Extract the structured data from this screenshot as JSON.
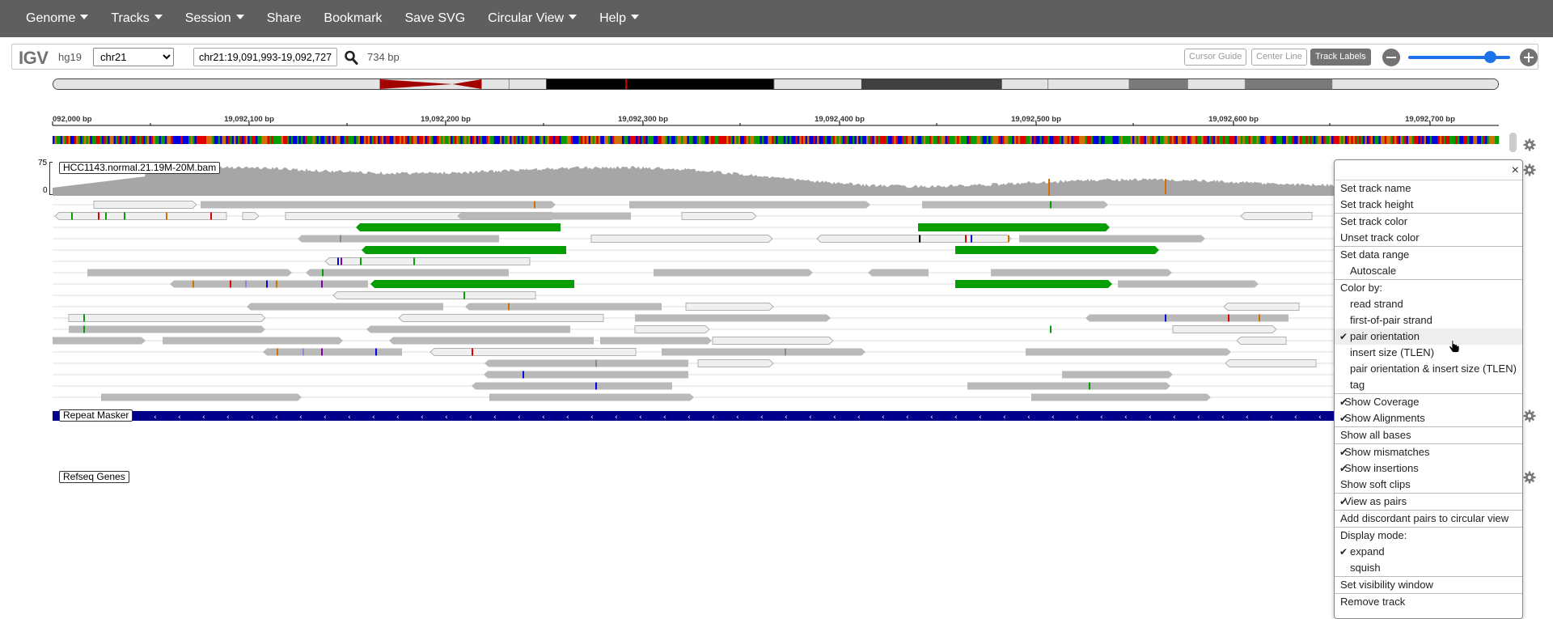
{
  "nav": {
    "items": [
      {
        "label": "Genome",
        "dropdown": true
      },
      {
        "label": "Tracks",
        "dropdown": true
      },
      {
        "label": "Session",
        "dropdown": true
      },
      {
        "label": "Share",
        "dropdown": false
      },
      {
        "label": "Bookmark",
        "dropdown": false
      },
      {
        "label": "Save SVG",
        "dropdown": false
      },
      {
        "label": "Circular View",
        "dropdown": true
      },
      {
        "label": "Help",
        "dropdown": true
      }
    ]
  },
  "toolbar": {
    "logo": "IGV",
    "genome": "hg19",
    "chromosome": "chr21",
    "locus": "chr21:19,091,993-19,092,727",
    "bp_width": "734 bp",
    "cursor_guide": "Cursor Guide",
    "center_line": "Center Line",
    "track_labels": "Track Labels",
    "zoom_level": 0.8
  },
  "ruler": {
    "ticks": [
      "092,000 bp",
      "19,092,100 bp",
      "19,092,200 bp",
      "19,092,300 bp",
      "19,092,400 bp",
      "19,092,500 bp",
      "19,092,600 bp",
      "19,092,700 bp"
    ]
  },
  "tracks": {
    "alignment_name": "HCC1143.normal.21.19M-20M.bam",
    "coverage_max": "75",
    "coverage_min": "0",
    "repeat_name": "Repeat Masker",
    "refseq_name": "Refseq Genes"
  },
  "colors": {
    "navbar": "#5f5f5f",
    "read_gray": "#b9b9b9",
    "read_light": "#f0f0f0",
    "pair_green": "#079d07",
    "coverage": "#a6a6a6",
    "repeat_blue": "#00008b",
    "accent_blue": "#1d72ea",
    "centromere_red": "#a30000"
  },
  "menu": {
    "close": "×",
    "items": [
      {
        "label": "Set track name",
        "type": "item"
      },
      {
        "label": "Set track height",
        "type": "item"
      },
      {
        "type": "sep"
      },
      {
        "label": "Set track color",
        "type": "item"
      },
      {
        "label": "Unset track color",
        "type": "item"
      },
      {
        "type": "sep"
      },
      {
        "label": "Set data range",
        "type": "item"
      },
      {
        "label": "Autoscale",
        "type": "sub"
      },
      {
        "type": "sep"
      },
      {
        "label": "Color by:",
        "type": "section"
      },
      {
        "label": "read strand",
        "type": "sub"
      },
      {
        "label": "first-of-pair strand",
        "type": "sub"
      },
      {
        "label": "pair orientation",
        "type": "sub",
        "checked": true,
        "hover": true
      },
      {
        "label": "insert size (TLEN)",
        "type": "sub"
      },
      {
        "label": "pair orientation & insert size (TLEN)",
        "type": "sub"
      },
      {
        "label": "tag",
        "type": "sub"
      },
      {
        "type": "sep"
      },
      {
        "label": "Show Coverage",
        "type": "item",
        "checked": true
      },
      {
        "label": "Show Alignments",
        "type": "item",
        "checked": true
      },
      {
        "type": "sep"
      },
      {
        "label": "Show all bases",
        "type": "item"
      },
      {
        "type": "sep"
      },
      {
        "label": "Show mismatches",
        "type": "item",
        "checked": true
      },
      {
        "label": "Show insertions",
        "type": "item",
        "checked": true
      },
      {
        "label": "Show soft clips",
        "type": "item"
      },
      {
        "type": "sep"
      },
      {
        "label": "View as pairs",
        "type": "item",
        "checked": true
      },
      {
        "type": "sep"
      },
      {
        "label": "Add discordant pairs to circular view",
        "type": "item"
      },
      {
        "type": "sep"
      },
      {
        "label": "Display mode:",
        "type": "section"
      },
      {
        "label": "expand",
        "type": "sub",
        "checked": true
      },
      {
        "label": "squish",
        "type": "sub"
      },
      {
        "type": "sep"
      },
      {
        "label": "Set visibility window",
        "type": "item"
      },
      {
        "type": "sep"
      },
      {
        "label": "Remove track",
        "type": "item"
      }
    ]
  }
}
